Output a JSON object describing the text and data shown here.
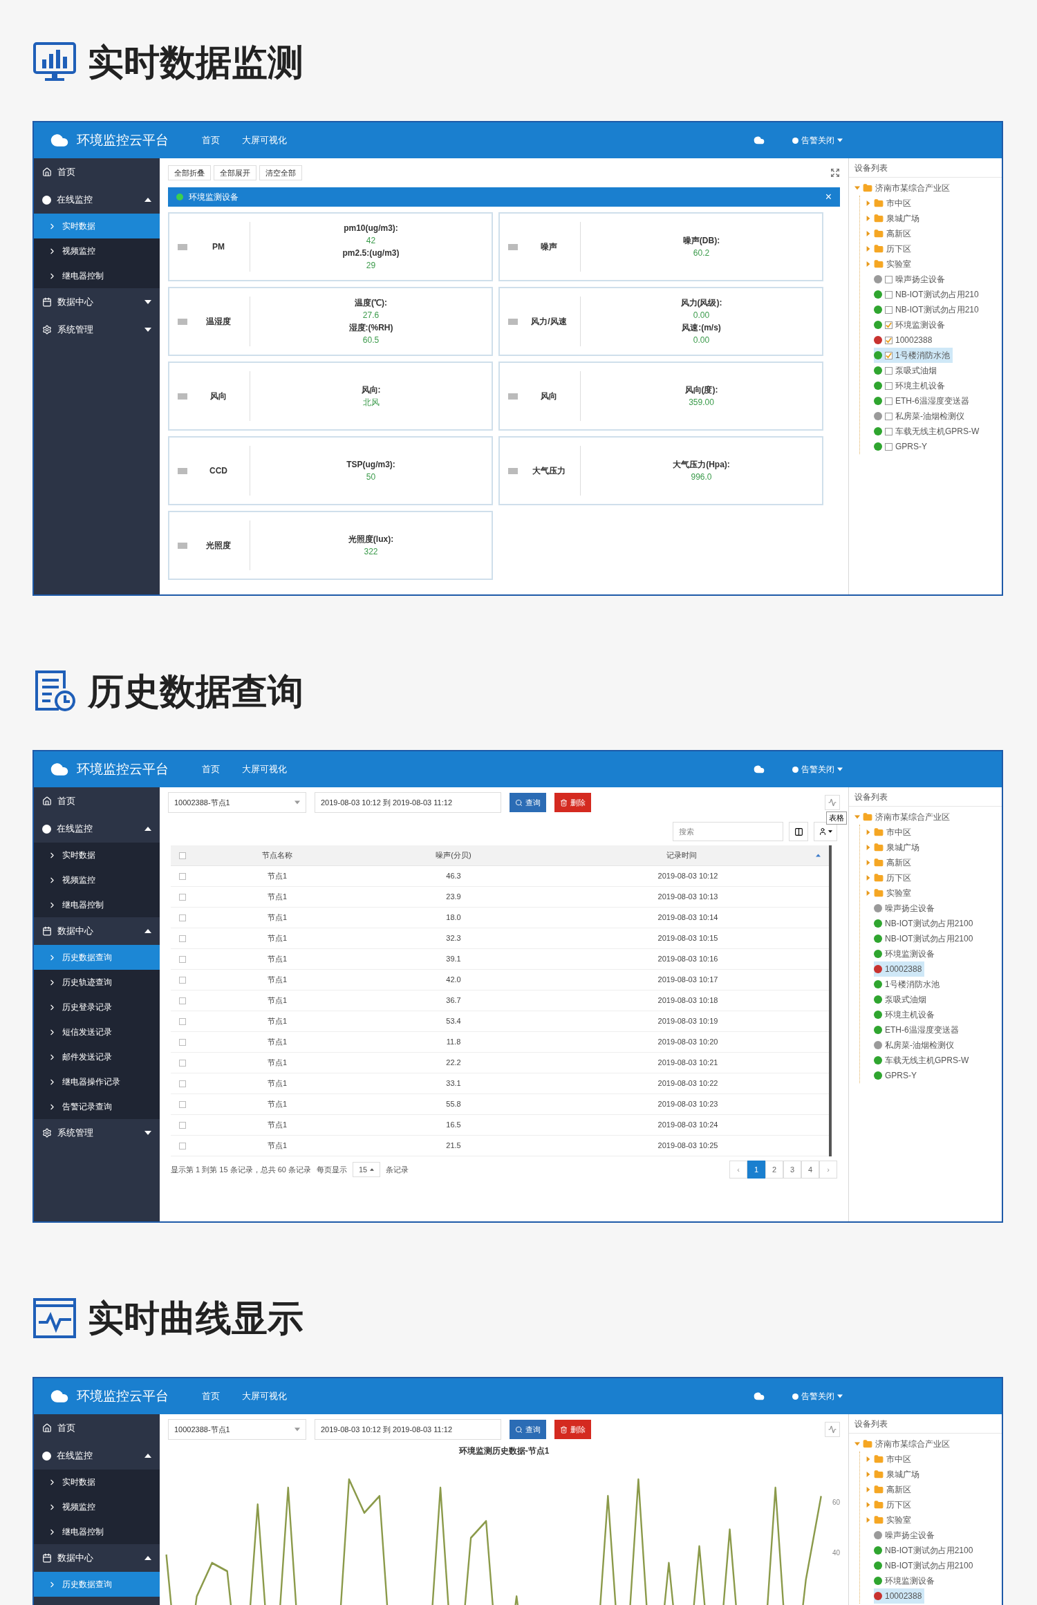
{
  "sections": [
    {
      "kind": "realtime",
      "heading": "实时数据监测",
      "app": {
        "brand": "环境监控云平台",
        "nav": [
          "首页",
          "大屏可视化"
        ],
        "alarm": "告警关闭",
        "sidebar": [
          {
            "label": "首页"
          },
          {
            "label": "在线监控",
            "expanded": true,
            "children": [
              {
                "label": "实时数据",
                "selected": true
              },
              {
                "label": "视频监控",
                "selected": false
              },
              {
                "label": "继电器控制",
                "selected": false
              }
            ]
          },
          {
            "label": "数据中心",
            "expanded": false
          },
          {
            "label": "系统管理",
            "expanded": false
          }
        ],
        "toolbar": [
          "全部折叠",
          "全部展开",
          "清空全部"
        ],
        "panel": {
          "title": "环境监测设备",
          "close": "×",
          "cards": [
            {
              "name": "PM",
              "readings": [
                {
                  "label": "pm10(ug/m3):",
                  "value": "42"
                },
                {
                  "label": "pm2.5:(ug/m3)",
                  "value": "29"
                }
              ]
            },
            {
              "name": "噪声",
              "readings": [
                {
                  "label": "噪声(DB):",
                  "value": "60.2"
                }
              ]
            },
            {
              "name": "温湿度",
              "readings": [
                {
                  "label": "温度(℃):",
                  "value": "27.6"
                },
                {
                  "label": "湿度:(%RH)",
                  "value": "60.5"
                }
              ]
            },
            {
              "name": "风力/风速",
              "readings": [
                {
                  "label": "风力(风级):",
                  "value": "0.00"
                },
                {
                  "label": "风速:(m/s)",
                  "value": "0.00"
                }
              ]
            },
            {
              "name": "风向",
              "readings": [
                {
                  "label": "风向:",
                  "value": "北风"
                }
              ]
            },
            {
              "name": "风向",
              "readings": [
                {
                  "label": "风向(度):",
                  "value": "359.00"
                }
              ]
            },
            {
              "name": "CCD",
              "readings": [
                {
                  "label": "TSP(ug/m3):",
                  "value": "50"
                }
              ]
            },
            {
              "name": "大气压力",
              "readings": [
                {
                  "label": "大气压力(Hpa):",
                  "value": "996.0"
                }
              ]
            },
            {
              "name": "光照度",
              "readings": [
                {
                  "label": "光照度(lux):",
                  "value": "322"
                }
              ]
            }
          ]
        },
        "tree": {
          "title": "设备列表",
          "root": {
            "label": "济南市某综合产业区",
            "expanded": true,
            "children": [
              {
                "kind": "folder",
                "label": "市中区",
                "expanded": false
              },
              {
                "kind": "folder",
                "label": "泉城广场",
                "expanded": false
              },
              {
                "kind": "folder",
                "label": "高新区",
                "expanded": false
              },
              {
                "kind": "folder",
                "label": "历下区",
                "expanded": false
              },
              {
                "kind": "folder",
                "label": "实验室",
                "expanded": false
              },
              {
                "kind": "device",
                "label": "噪声扬尘设备",
                "color": "#9a9a9a",
                "checked": false,
                "selected": false
              },
              {
                "kind": "device",
                "label": "NB-IOT测试勿占用210",
                "color": "#2fa52f",
                "checked": false,
                "selected": false
              },
              {
                "kind": "device",
                "label": "NB-IOT测试勿占用210",
                "color": "#2fa52f",
                "checked": false,
                "selected": false
              },
              {
                "kind": "device",
                "label": "环境监测设备",
                "color": "#2fa52f",
                "checked": true,
                "selected": false
              },
              {
                "kind": "device",
                "label": "10002388",
                "color": "#c8322f",
                "checked": true,
                "selected": false
              },
              {
                "kind": "device",
                "label": "1号楼消防水池",
                "color": "#2fa52f",
                "checked": true,
                "selected": true
              },
              {
                "kind": "device",
                "label": "泵吸式油烟",
                "color": "#2fa52f",
                "checked": false,
                "selected": false
              },
              {
                "kind": "device",
                "label": "环境主机设备",
                "color": "#2fa52f",
                "checked": false,
                "selected": false
              },
              {
                "kind": "device",
                "label": "ETH-6温湿度变送器",
                "color": "#2fa52f",
                "checked": false,
                "selected": false
              },
              {
                "kind": "device",
                "label": "私房菜-油烟检测仪",
                "color": "#9a9a9a",
                "checked": false,
                "selected": false
              },
              {
                "kind": "device",
                "label": "车载无线主机GPRS-W",
                "color": "#2fa52f",
                "checked": false,
                "selected": false
              },
              {
                "kind": "device",
                "label": "GPRS-Y",
                "color": "#2fa52f",
                "checked": false,
                "selected": false
              }
            ]
          }
        }
      }
    },
    {
      "kind": "history",
      "heading": "历史数据查询",
      "app": {
        "brand": "环境监控云平台",
        "nav": [
          "首页",
          "大屏可视化"
        ],
        "alarm": "告警关闭",
        "sidebar": [
          {
            "label": "首页"
          },
          {
            "label": "在线监控",
            "expanded": true,
            "children": [
              {
                "label": "实时数据",
                "selected": false
              },
              {
                "label": "视频监控",
                "selected": false
              },
              {
                "label": "继电器控制",
                "selected": false
              }
            ]
          },
          {
            "label": "数据中心",
            "expanded": true,
            "children": [
              {
                "label": "历史数据查询",
                "selected": true
              },
              {
                "label": "历史轨迹查询",
                "selected": false
              },
              {
                "label": "历史登录记录",
                "selected": false
              },
              {
                "label": "短信发送记录",
                "selected": false
              },
              {
                "label": "邮件发送记录",
                "selected": false
              },
              {
                "label": "继电器操作记录",
                "selected": false
              },
              {
                "label": "告警记录查询",
                "selected": false
              }
            ]
          },
          {
            "label": "系统管理",
            "expanded": false
          }
        ],
        "query": {
          "device": "10002388-节点1",
          "range": "2019-08-03 10:12 到 2019-08-03 11:12",
          "query_button": "查询",
          "delete_button": "删除",
          "tooltip": "表格"
        },
        "search": {
          "placeholder": "搜索"
        },
        "table": {
          "all_checked": false,
          "columns": [
            "节点名称",
            "噪声(分贝)",
            "记录时间"
          ],
          "rows": [
            {
              "checked": false,
              "cells": [
                "节点1",
                "46.3",
                "2019-08-03 10:12"
              ]
            },
            {
              "checked": false,
              "cells": [
                "节点1",
                "23.9",
                "2019-08-03 10:13"
              ]
            },
            {
              "checked": false,
              "cells": [
                "节点1",
                "18.0",
                "2019-08-03 10:14"
              ]
            },
            {
              "checked": false,
              "cells": [
                "节点1",
                "32.3",
                "2019-08-03 10:15"
              ]
            },
            {
              "checked": false,
              "cells": [
                "节点1",
                "39.1",
                "2019-08-03 10:16"
              ]
            },
            {
              "checked": false,
              "cells": [
                "节点1",
                "42.0",
                "2019-08-03 10:17"
              ]
            },
            {
              "checked": false,
              "cells": [
                "节点1",
                "36.7",
                "2019-08-03 10:18"
              ]
            },
            {
              "checked": false,
              "cells": [
                "节点1",
                "53.4",
                "2019-08-03 10:19"
              ]
            },
            {
              "checked": false,
              "cells": [
                "节点1",
                "11.8",
                "2019-08-03 10:20"
              ]
            },
            {
              "checked": false,
              "cells": [
                "节点1",
                "22.2",
                "2019-08-03 10:21"
              ]
            },
            {
              "checked": false,
              "cells": [
                "节点1",
                "33.1",
                "2019-08-03 10:22"
              ]
            },
            {
              "checked": false,
              "cells": [
                "节点1",
                "55.8",
                "2019-08-03 10:23"
              ]
            },
            {
              "checked": false,
              "cells": [
                "节点1",
                "16.5",
                "2019-08-03 10:24"
              ]
            },
            {
              "checked": false,
              "cells": [
                "节点1",
                "21.5",
                "2019-08-03 10:25"
              ]
            }
          ]
        },
        "footer": {
          "summary": "显示第 1 到第 15 条记录，总共 60 条记录",
          "per_page_label": "每页显示",
          "per_page": "15",
          "per_page_suffix": "条记录"
        },
        "pagination": {
          "prev": "‹",
          "next": "›",
          "pages": [
            {
              "label": "1",
              "selected": true
            },
            {
              "label": "2",
              "selected": false
            },
            {
              "label": "3",
              "selected": false
            },
            {
              "label": "4",
              "selected": false
            }
          ]
        },
        "tree": {
          "title": "设备列表",
          "root": {
            "label": "济南市某综合产业区",
            "expanded": true,
            "children": [
              {
                "kind": "folder",
                "label": "市中区",
                "expanded": false
              },
              {
                "kind": "folder",
                "label": "泉城广场",
                "expanded": false
              },
              {
                "kind": "folder",
                "label": "高新区",
                "expanded": false
              },
              {
                "kind": "folder",
                "label": "历下区",
                "expanded": false
              },
              {
                "kind": "folder",
                "label": "实验室",
                "expanded": false
              },
              {
                "kind": "device",
                "label": "噪声扬尘设备",
                "color": "#9a9a9a",
                "selected": false
              },
              {
                "kind": "device",
                "label": "NB-IOT测试勿占用2100",
                "color": "#2fa52f",
                "selected": false
              },
              {
                "kind": "device",
                "label": "NB-IOT测试勿占用2100",
                "color": "#2fa52f",
                "selected": false
              },
              {
                "kind": "device",
                "label": "环境监测设备",
                "color": "#2fa52f",
                "selected": false
              },
              {
                "kind": "device",
                "label": "10002388",
                "color": "#c8322f",
                "selected": true
              },
              {
                "kind": "device",
                "label": "1号楼消防水池",
                "color": "#2fa52f",
                "selected": false
              },
              {
                "kind": "device",
                "label": "泵吸式油烟",
                "color": "#2fa52f",
                "selected": false
              },
              {
                "kind": "device",
                "label": "环境主机设备",
                "color": "#2fa52f",
                "selected": false
              },
              {
                "kind": "device",
                "label": "ETH-6温湿度变送器",
                "color": "#2fa52f",
                "selected": false
              },
              {
                "kind": "device",
                "label": "私房菜-油烟检测仪",
                "color": "#9a9a9a",
                "selected": false
              },
              {
                "kind": "device",
                "label": "车载无线主机GPRS-W",
                "color": "#2fa52f",
                "selected": false
              },
              {
                "kind": "device",
                "label": "GPRS-Y",
                "color": "#2fa52f",
                "selected": false
              }
            ]
          }
        }
      }
    },
    {
      "kind": "curve",
      "heading": "实时曲线显示",
      "app": {
        "brand": "环境监控云平台",
        "nav": [
          "首页",
          "大屏可视化"
        ],
        "alarm": "告警关闭",
        "sidebar": [
          {
            "label": "首页"
          },
          {
            "label": "在线监控",
            "expanded": true,
            "children": [
              {
                "label": "实时数据",
                "selected": false
              },
              {
                "label": "视频监控",
                "selected": false
              },
              {
                "label": "继电器控制",
                "selected": false
              }
            ]
          },
          {
            "label": "数据中心",
            "expanded": true,
            "children": [
              {
                "label": "历史数据查询",
                "selected": true
              }
            ]
          }
        ],
        "query": {
          "device": "10002388-节点1",
          "range": "2019-08-03 10:12 到 2019-08-03 11:12",
          "query_button": "查询",
          "delete_button": "删除"
        },
        "chart": {
          "title": "环境监测历史数据-节点1",
          "axis_labels": [
            "60",
            "40"
          ]
        },
        "tree": {
          "title": "设备列表",
          "root": {
            "label": "济南市某综合产业区",
            "expanded": true,
            "children": [
              {
                "kind": "folder",
                "label": "市中区",
                "expanded": false
              },
              {
                "kind": "folder",
                "label": "泉城广场",
                "expanded": false
              },
              {
                "kind": "folder",
                "label": "高新区",
                "expanded": false
              },
              {
                "kind": "folder",
                "label": "历下区",
                "expanded": false
              },
              {
                "kind": "folder",
                "label": "实验室",
                "expanded": false
              },
              {
                "kind": "device",
                "label": "噪声扬尘设备",
                "color": "#9a9a9a",
                "selected": false
              },
              {
                "kind": "device",
                "label": "NB-IOT测试勿占用2100",
                "color": "#2fa52f",
                "selected": false
              },
              {
                "kind": "device",
                "label": "NB-IOT测试勿占用2100",
                "color": "#2fa52f",
                "selected": false
              },
              {
                "kind": "device",
                "label": "环境监测设备",
                "color": "#2fa52f",
                "selected": false
              },
              {
                "kind": "device",
                "label": "10002388",
                "color": "#c8322f",
                "selected": true
              }
            ]
          }
        }
      }
    }
  ]
}
